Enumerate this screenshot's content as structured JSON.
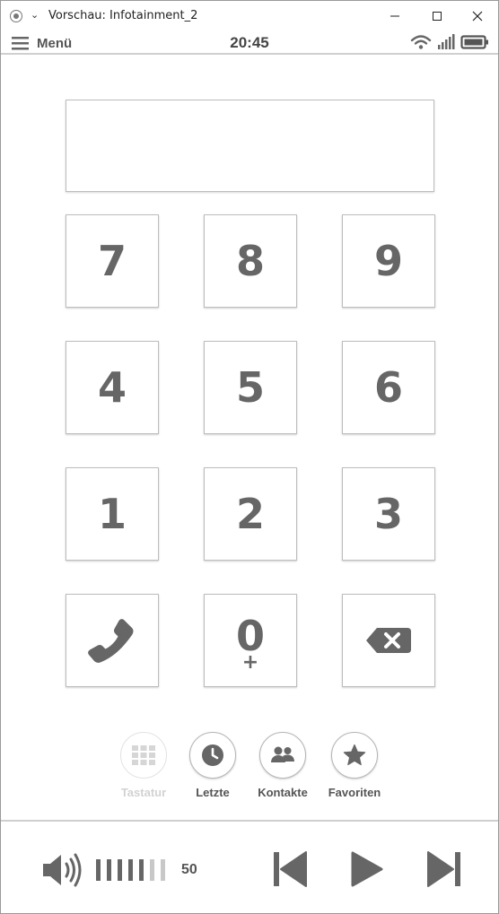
{
  "window": {
    "title": "Vorschau: Infotainment_2",
    "chevron": "⌄",
    "minimize_glyph": "—",
    "maximize_glyph": "☐",
    "close_glyph": "✕"
  },
  "statusbar": {
    "menu_label": "Menü",
    "time": "20:45",
    "icons": [
      "wifi-icon",
      "signal-icon",
      "battery-icon"
    ]
  },
  "dialer": {
    "display_value": "",
    "keys": [
      {
        "digit": "7"
      },
      {
        "digit": "8"
      },
      {
        "digit": "9"
      },
      {
        "digit": "4"
      },
      {
        "digit": "5"
      },
      {
        "digit": "6"
      },
      {
        "digit": "1"
      },
      {
        "digit": "2"
      },
      {
        "digit": "3"
      },
      {
        "icon": "phone-icon"
      },
      {
        "digit": "0",
        "sub": "+"
      },
      {
        "icon": "backspace-icon"
      }
    ]
  },
  "tabs": [
    {
      "label": "Tastatur",
      "icon": "keypad-icon",
      "state": "disabled"
    },
    {
      "label": "Letzte",
      "icon": "clock-icon",
      "state": "normal"
    },
    {
      "label": "Kontakte",
      "icon": "contacts-icon",
      "state": "normal"
    },
    {
      "label": "Favoriten",
      "icon": "star-icon",
      "state": "normal"
    }
  ],
  "media": {
    "volume": 50,
    "volume_bars_active": 5,
    "volume_bars_total": 7,
    "controls": [
      "previous-icon",
      "play-icon",
      "next-icon"
    ]
  },
  "colors": {
    "text": "#666666",
    "border": "#bdbdbd",
    "disabled": "#d2d2d2",
    "volume_inactive": "#c8c8c8"
  }
}
